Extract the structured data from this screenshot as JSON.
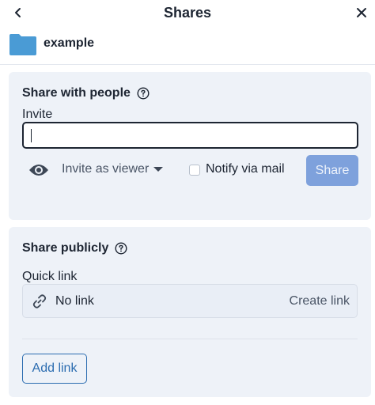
{
  "header": {
    "title": "Shares",
    "back_icon": "chevron-left-icon",
    "close_icon": "close-icon"
  },
  "resource": {
    "name": "example",
    "icon": "folder-icon",
    "icon_color": "#4a9bd5"
  },
  "share_with_people": {
    "heading": "Share with people",
    "invite_label": "Invite",
    "invite_value": "",
    "role_label": "Invite as viewer",
    "role_icon": "eye-icon",
    "notify_label": "Notify via mail",
    "notify_checked": false,
    "share_button_label": "Share",
    "share_button_color": "#7ea1dc"
  },
  "share_publicly": {
    "heading": "Share publicly",
    "quick_link_label": "Quick link",
    "no_link_text": "No link",
    "create_link_label": "Create link",
    "add_link_label": "Add link",
    "accent_color": "#2b6cb0"
  }
}
